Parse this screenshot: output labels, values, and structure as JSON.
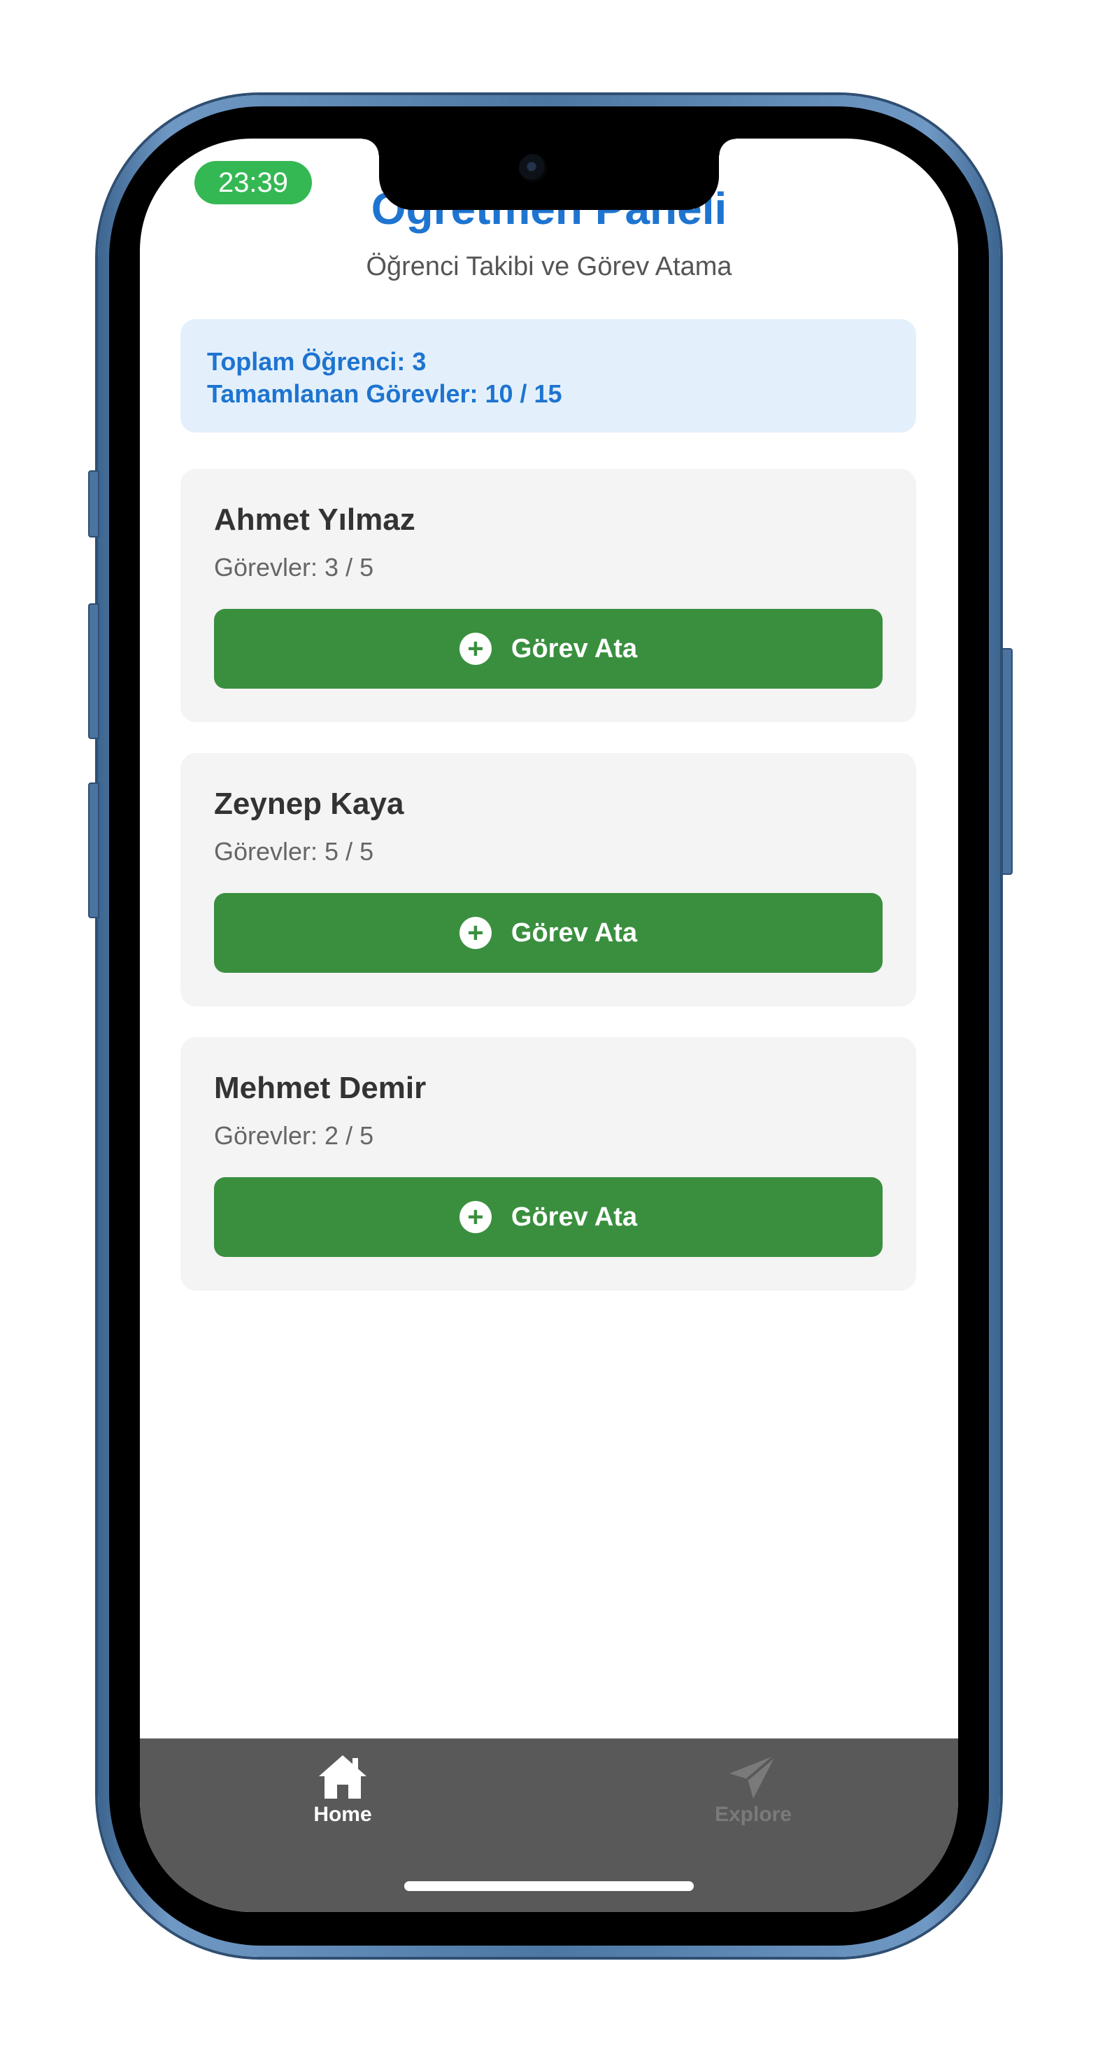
{
  "status_bar": {
    "time": "23:39",
    "accent": "#34b853"
  },
  "header": {
    "title": "Öğretmen Paneli",
    "subtitle": "Öğrenci Takibi ve Görev Atama",
    "accent": "#1e74d0"
  },
  "summary": {
    "total_students": "Toplam Öğrenci: 3",
    "completed_tasks": "Tamamlanan Görevler: 10 / 15"
  },
  "students": [
    {
      "name": "Ahmet Yılmaz",
      "tasks": "Görevler: 3 / 5",
      "button_label": "Görev Ata",
      "button_icon": "plus-circle-icon"
    },
    {
      "name": "Zeynep Kaya",
      "tasks": "Görevler: 5 / 5",
      "button_label": "Görev Ata",
      "button_icon": "plus-circle-icon"
    },
    {
      "name": "Mehmet Demir",
      "tasks": "Görevler: 2 / 5",
      "button_label": "Görev Ata",
      "button_icon": "plus-circle-icon"
    }
  ],
  "button_color": "#3a8f3f",
  "tab_bar": {
    "background": "#595959",
    "tabs": [
      {
        "label": "Home",
        "icon": "home-icon",
        "active": true
      },
      {
        "label": "Explore",
        "icon": "paper-plane-icon",
        "active": false
      }
    ]
  }
}
